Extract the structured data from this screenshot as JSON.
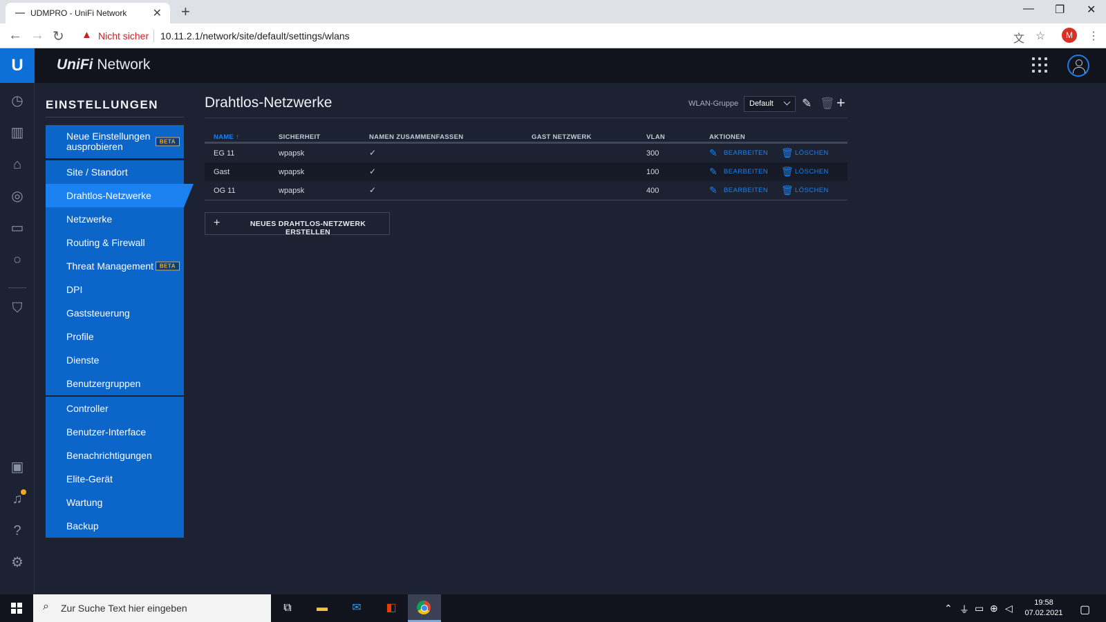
{
  "browser": {
    "tab_title": "UDMPRO - UniFi Network",
    "insecure_label": "Nicht sicher",
    "url": "10.11.2.1/network/site/default/settings/wlans",
    "profile_initial": "M"
  },
  "app": {
    "brand_prefix": "UniFi",
    "brand_suffix": "Network",
    "logo_letter": "U"
  },
  "settings_nav": {
    "title": "EINSTELLUNGEN",
    "beta_label": "BETA",
    "group1": [
      {
        "label_line1": "Neue Einstellungen",
        "label_line2": "ausprobieren"
      }
    ],
    "group2": [
      {
        "label": "Site / Standort"
      },
      {
        "label": "Drahtlos-Netzwerke"
      },
      {
        "label": "Netzwerke"
      },
      {
        "label": "Routing & Firewall"
      },
      {
        "label": "Threat Management"
      },
      {
        "label": "DPI"
      },
      {
        "label": "Gaststeuerung"
      },
      {
        "label": "Profile"
      },
      {
        "label": "Dienste"
      },
      {
        "label": "Benutzergruppen"
      }
    ],
    "group3": [
      {
        "label": "Controller"
      },
      {
        "label": "Benutzer-Interface"
      },
      {
        "label": "Benachrichtigungen"
      },
      {
        "label": "Elite-Gerät"
      },
      {
        "label": "Wartung"
      },
      {
        "label": "Backup"
      }
    ]
  },
  "main": {
    "title": "Drahtlos-Netzwerke",
    "wlan_group_label": "WLAN-Gruppe",
    "wlan_group_value": "Default",
    "columns": {
      "name": "NAME",
      "security": "SICHERHEIT",
      "merge_names": "NAMEN ZUSAMMENFASSEN",
      "guest": "GAST NETZWERK",
      "vlan": "VLAN",
      "actions": "AKTIONEN"
    },
    "rows": [
      {
        "name": "EG 11",
        "security": "wpapsk",
        "merge": "✓",
        "guest": "",
        "vlan": "300"
      },
      {
        "name": "Gast",
        "security": "wpapsk",
        "merge": "✓",
        "guest": "",
        "vlan": "100"
      },
      {
        "name": "OG 11",
        "security": "wpapsk",
        "merge": "✓",
        "guest": "",
        "vlan": "400"
      }
    ],
    "edit_label": "BEARBEITEN",
    "delete_label": "LÖSCHEN",
    "new_button_label": "NEUES DRAHTLOS-NETZWERK ERSTELLEN"
  },
  "taskbar": {
    "search_placeholder": "Zur Suche Text hier eingeben",
    "time": "19:58",
    "date": "07.02.2021"
  },
  "colors": {
    "accent": "#1b80f0",
    "nav_bg": "#0c65c8",
    "beta": "#f5a623",
    "page_bg": "#1d2232"
  }
}
